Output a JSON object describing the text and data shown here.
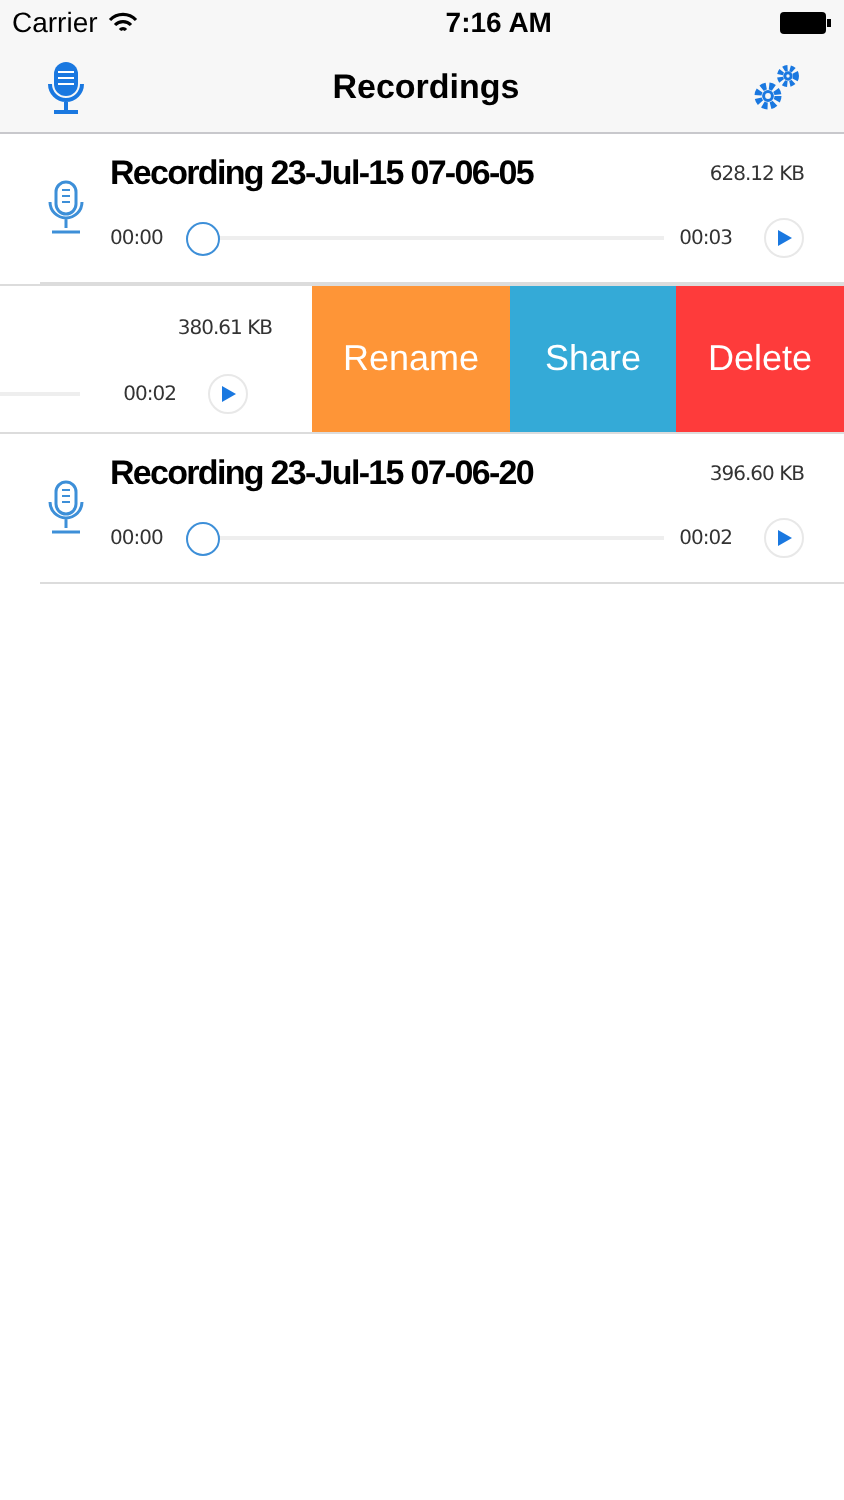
{
  "status_bar": {
    "carrier": "Carrier",
    "time": "7:16 AM"
  },
  "nav": {
    "title": "Recordings"
  },
  "recordings": [
    {
      "kind": "normal",
      "title": "Recording 23-Jul-15 07-06-05",
      "size": "628.12 KB",
      "start": "00:00",
      "end": "00:03",
      "level": 0
    },
    {
      "kind": "swiped",
      "size": "380.61 KB",
      "end": "00:02",
      "actions": [
        {
          "label": "Rename",
          "color": "#fe9537"
        },
        {
          "label": "Share",
          "color": "#34aad7"
        },
        {
          "label": "Delete",
          "color": "#fe3b3b"
        }
      ]
    },
    {
      "kind": "normal",
      "title": "Recording 23-Jul-15 07-06-20",
      "size": "396.60 KB",
      "start": "00:00",
      "end": "00:02",
      "level": 0
    }
  ]
}
